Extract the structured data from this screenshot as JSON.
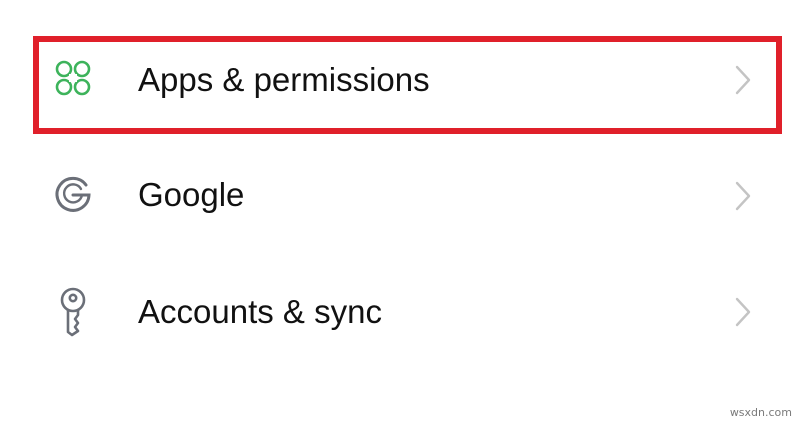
{
  "settings": {
    "items": [
      {
        "label": "Apps & permissions",
        "icon": "apps-grid-icon",
        "icon_color": "#3db35b",
        "highlighted": true
      },
      {
        "label": "Google",
        "icon": "google-g-icon",
        "icon_color": "#6b6f78",
        "highlighted": false
      },
      {
        "label": "Accounts & sync",
        "icon": "key-icon",
        "icon_color": "#6b6f78",
        "highlighted": false
      }
    ]
  },
  "highlight": {
    "color": "#e0202a"
  },
  "chevron_color": "#c4c4c4",
  "watermark": "wsxdn.com"
}
